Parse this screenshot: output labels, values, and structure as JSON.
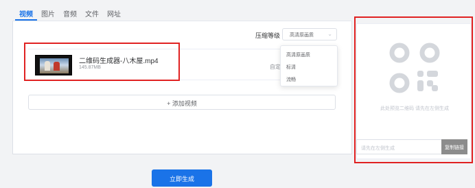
{
  "tabs": [
    {
      "label": "视频",
      "active": true
    },
    {
      "label": "图片",
      "active": false
    },
    {
      "label": "音频",
      "active": false
    },
    {
      "label": "文件",
      "active": false
    },
    {
      "label": "网址",
      "active": false
    }
  ],
  "compression": {
    "label": "压缩等级",
    "selected": "高清原画质",
    "options": [
      "高清原画质",
      "标清",
      "流畅"
    ]
  },
  "file": {
    "name": "二维码生成器-八木屋.mp4",
    "size": "145.87MB",
    "custom_label": "自定"
  },
  "add_video_label": "+ 添加视频",
  "qr": {
    "icon": "qr-code-icon",
    "hint": "此处预览二维码 请先在左侧生成",
    "input_placeholder": "请先在左侧生成",
    "copy_label": "复制链接"
  },
  "generate_label": "立即生成",
  "colors": {
    "accent": "#1a73e8",
    "highlight": "#e02020"
  }
}
